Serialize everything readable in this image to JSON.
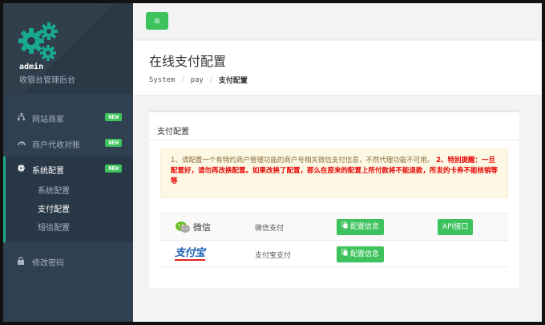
{
  "sidebar": {
    "username": "admin",
    "subtitle": "收银台管理后台",
    "items": [
      {
        "label": "网站商家",
        "badge": "NEW",
        "icon": "sitemap-icon"
      },
      {
        "label": "商户代收对账",
        "badge": "NEW",
        "icon": "dashboard-icon"
      },
      {
        "label": "系统配置",
        "badge": "NEW",
        "icon": "gear-icon"
      }
    ],
    "submenu": [
      "系统配置",
      "支付配置",
      "短信配置"
    ],
    "password_item": {
      "label": "修改密码",
      "icon": "lock-icon"
    }
  },
  "topbar": {
    "toggle_icon": "≡"
  },
  "heading": {
    "title": "在线支付配置",
    "breadcrumb": [
      "System",
      "pay",
      "支付配置"
    ]
  },
  "panel": {
    "title": "支付配置",
    "notice_normal": "1、请配置一个有特约商户管理功能的商户号相关微信支付信息，不然代理功能不可用。",
    "notice_warn": "2、特别提醒：一旦配置好，请勿再改换配置。如果改换了配置，那么在原来的配置上所付款将不能退款，所发的卡券不能核销等等"
  },
  "payments": [
    {
      "logo_text": "微信",
      "name": "微信支付",
      "config_label": "配置信息",
      "api_label": "API接口"
    },
    {
      "logo_text": "支付宝",
      "name": "支付宝支付",
      "config_label": "配置信息"
    }
  ],
  "colors": {
    "sidebar": "#2f4050",
    "accent_green": "#3ec25e",
    "warn_red": "#e60000",
    "notice_bg": "#fcf8e3"
  }
}
